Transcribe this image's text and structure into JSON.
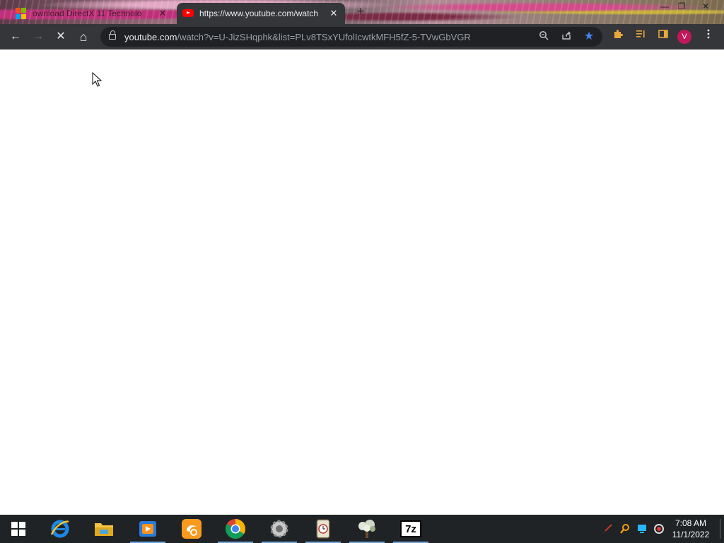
{
  "tabs": [
    {
      "title": "ownload DirectX 11 Technolo",
      "active": false,
      "close": "✕"
    },
    {
      "title": "https://www.youtube.com/watch",
      "active": true,
      "close": "✕"
    }
  ],
  "newtab_label": "+",
  "window_controls": {
    "minimize": "—",
    "maximize": "❐",
    "close": "✕"
  },
  "toolbar": {
    "back": "←",
    "forward": "→",
    "stop": "✕",
    "home": "⌂"
  },
  "address": {
    "host": "youtube.com",
    "rest": "/watch?v=U-JizSHqphk&list=PLv8TSxYUfolIcwtkMFH5fZ-5-TVwGbVGR"
  },
  "omnibox_icons": [
    "zoom-icon",
    "share-icon",
    "bookmark-star-icon"
  ],
  "profile_initial": "V",
  "taskbar": {
    "pinned": [
      "internet-explorer-icon",
      "file-explorer-icon",
      "media-player-icon",
      "uc-browser-icon",
      "chrome-icon",
      "settings-gear-app-icon",
      "clock-app-icon",
      "tree-app-icon",
      "7zip-icon"
    ],
    "sevenzip_label": "7z",
    "clock_time": "7:08 AM",
    "clock_date": "11/1/2022"
  },
  "colors": {
    "chrome_dark": "#35363a",
    "omnibox_bg": "#202124",
    "bookmark_star": "#4285f4",
    "taskbar_bg": "#1f2326",
    "profile_avatar": "#c2185b"
  }
}
